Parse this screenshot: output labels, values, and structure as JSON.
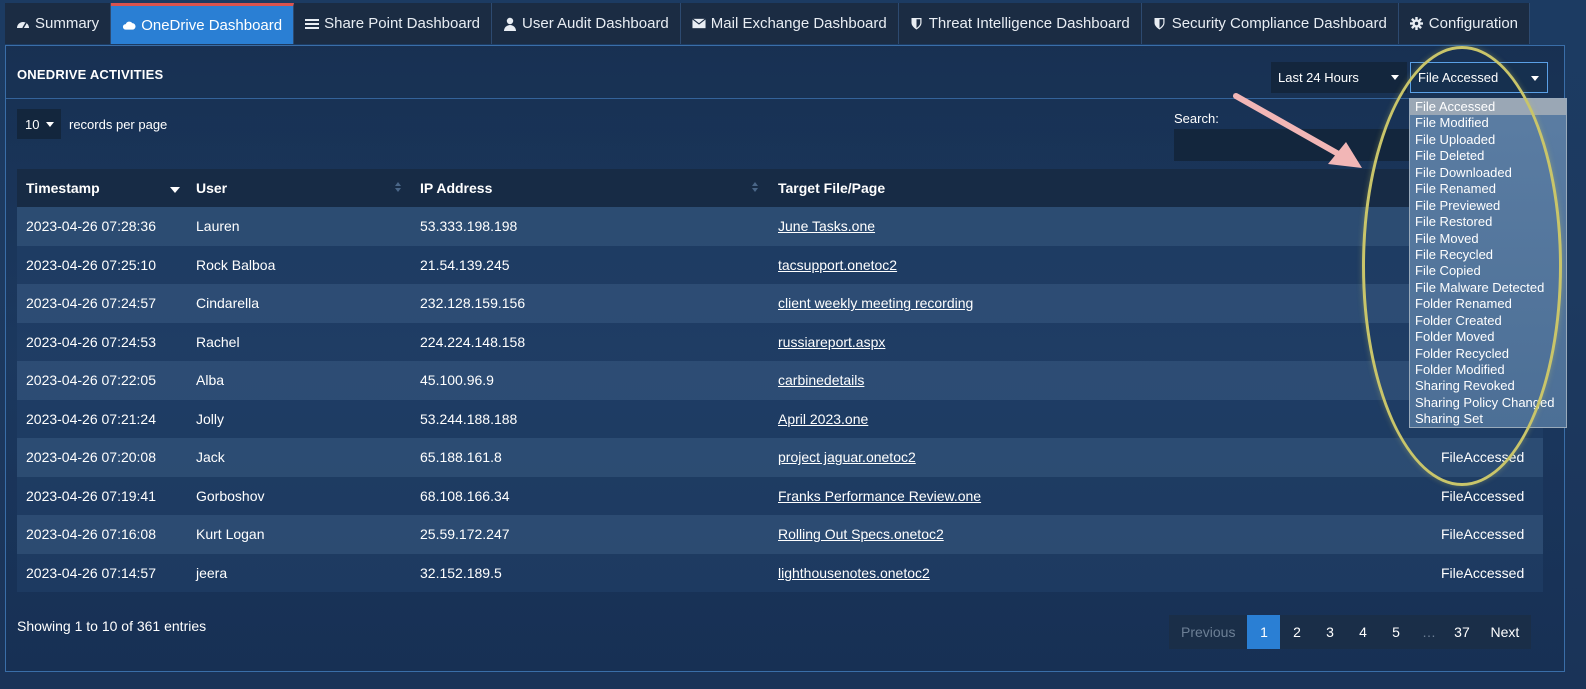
{
  "tabs": [
    {
      "label": "Summary",
      "icon": "dashboard-icon"
    },
    {
      "label": "OneDrive Dashboard",
      "icon": "cloud-icon",
      "active": true
    },
    {
      "label": "Share Point Dashboard",
      "icon": "list-icon"
    },
    {
      "label": "User Audit Dashboard",
      "icon": "user-icon"
    },
    {
      "label": "Mail Exchange Dashboard",
      "icon": "envelope-icon"
    },
    {
      "label": "Threat Intelligence Dashboard",
      "icon": "shield-icon"
    },
    {
      "label": "Security Compliance Dashboard",
      "icon": "shield-icon"
    },
    {
      "label": "Configuration",
      "icon": "gear-icon"
    }
  ],
  "panel": {
    "title": "ONEDRIVE ACTIVITIES",
    "period_select": "Last 24 Hours",
    "event_select": "File Accessed",
    "records_per_page_value": "10",
    "records_per_page_label": "records per page",
    "search_label": "Search:"
  },
  "table": {
    "headers": {
      "timestamp": "Timestamp",
      "user": "User",
      "ip": "IP Address",
      "target": "Target File/Page"
    },
    "rows": [
      {
        "ts": "2023-04-26 07:28:36",
        "user": "Lauren",
        "ip": "53.333.198.198",
        "target": "June Tasks.one",
        "op": ""
      },
      {
        "ts": "2023-04-26 07:25:10",
        "user": "Rock Balboa",
        "ip": "21.54.139.245",
        "target": "tacsupport.onetoc2",
        "op": ""
      },
      {
        "ts": "2023-04-26 07:24:57",
        "user": "Cindarella",
        "ip": "232.128.159.156",
        "target": "client weekly meeting recording",
        "op": ""
      },
      {
        "ts": "2023-04-26 07:24:53",
        "user": "Rachel",
        "ip": "224.224.148.158",
        "target": "russiareport.aspx",
        "op": ""
      },
      {
        "ts": "2023-04-26 07:22:05",
        "user": "Alba",
        "ip": "45.100.96.9",
        "target": "carbinedetails",
        "op": ""
      },
      {
        "ts": "2023-04-26 07:21:24",
        "user": "Jolly",
        "ip": "53.244.188.188",
        "target": "April 2023.one",
        "op": ""
      },
      {
        "ts": "2023-04-26 07:20:08",
        "user": "Jack",
        "ip": "65.188.161.8",
        "target": "project jaguar.onetoc2",
        "op": "FileAccessed"
      },
      {
        "ts": "2023-04-26 07:19:41",
        "user": "Gorboshov",
        "ip": "68.108.166.34",
        "target": "Franks Performance Review.one",
        "op": "FileAccessed"
      },
      {
        "ts": "2023-04-26 07:16:08",
        "user": "Kurt Logan",
        "ip": "25.59.172.247",
        "target": "Rolling Out Specs.onetoc2",
        "op": "FileAccessed"
      },
      {
        "ts": "2023-04-26 07:14:57",
        "user": "jeera",
        "ip": "32.152.189.5",
        "target": "lighthousenotes.onetoc2",
        "op": "FileAccessed"
      }
    ]
  },
  "info": "Showing 1 to 10 of 361 entries",
  "pagination": {
    "previous": "Previous",
    "pages": [
      "1",
      "2",
      "3",
      "4",
      "5"
    ],
    "ellipsis": "…",
    "last": "37",
    "next": "Next",
    "current": "1"
  },
  "dropdown_options": [
    "File Accessed",
    "File Modified",
    "File Uploaded",
    "File Deleted",
    "File Downloaded",
    "File Renamed",
    "File Previewed",
    "File Restored",
    "File Moved",
    "File Recycled",
    "File Copied",
    "File Malware Detected",
    "Folder Renamed",
    "Folder Created",
    "Folder Moved",
    "Folder Recycled",
    "Folder Modified",
    "Sharing Revoked",
    "Sharing Policy Changed",
    "Sharing Set"
  ],
  "colors": {
    "accent": "#2a7fd4",
    "active_tab_top": "#d9534f",
    "annotation_ellipse": "#c9c56a",
    "annotation_arrow": "#f2b6b6"
  }
}
